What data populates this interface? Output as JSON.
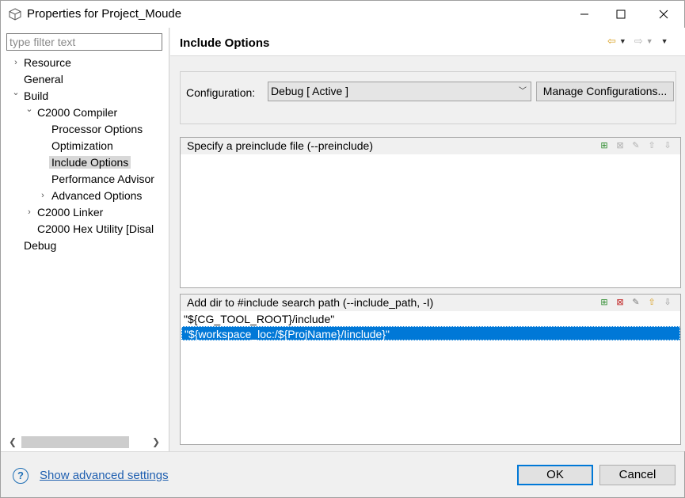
{
  "window": {
    "title": "Properties for Project_Moude"
  },
  "sidebar": {
    "filter_placeholder": "type filter text",
    "items": [
      {
        "label": "Resource",
        "level": 0,
        "arrow": "›"
      },
      {
        "label": "General",
        "level": 0,
        "arrow": ""
      },
      {
        "label": "Build",
        "level": 0,
        "arrow": "⌄"
      },
      {
        "label": "C2000 Compiler",
        "level": 1,
        "arrow": "⌄"
      },
      {
        "label": "Processor Options",
        "level": 2,
        "arrow": ""
      },
      {
        "label": "Optimization",
        "level": 2,
        "arrow": ""
      },
      {
        "label": "Include Options",
        "level": 2,
        "arrow": "",
        "selected": true
      },
      {
        "label": "Performance Advisor",
        "level": 2,
        "arrow": ""
      },
      {
        "label": "Advanced Options",
        "level": 2,
        "arrow": "›"
      },
      {
        "label": "C2000 Linker",
        "level": 1,
        "arrow": "›"
      },
      {
        "label": "C2000 Hex Utility  [Disal",
        "level": 1,
        "arrow": ""
      },
      {
        "label": "Debug",
        "level": 0,
        "arrow": ""
      }
    ]
  },
  "main": {
    "page_title": "Include Options",
    "configuration": {
      "label": "Configuration:",
      "selected": "Debug  [ Active ]",
      "manage_label": "Manage Configurations..."
    },
    "preinclude": {
      "title": "Specify a preinclude file (--preinclude)",
      "items": []
    },
    "include_path": {
      "title": "Add dir to #include search path (--include_path, -I)",
      "items": [
        "\"${CG_TOOL_ROOT}/include\"",
        "\"${workspace_loc:/${ProjName}/Iinclude}\""
      ],
      "selected_index": 1
    }
  },
  "footer": {
    "advanced_link": "Show advanced settings",
    "ok_label": "OK",
    "cancel_label": "Cancel"
  },
  "colors": {
    "selection": "#0078d7",
    "link": "#1f5fb0"
  }
}
